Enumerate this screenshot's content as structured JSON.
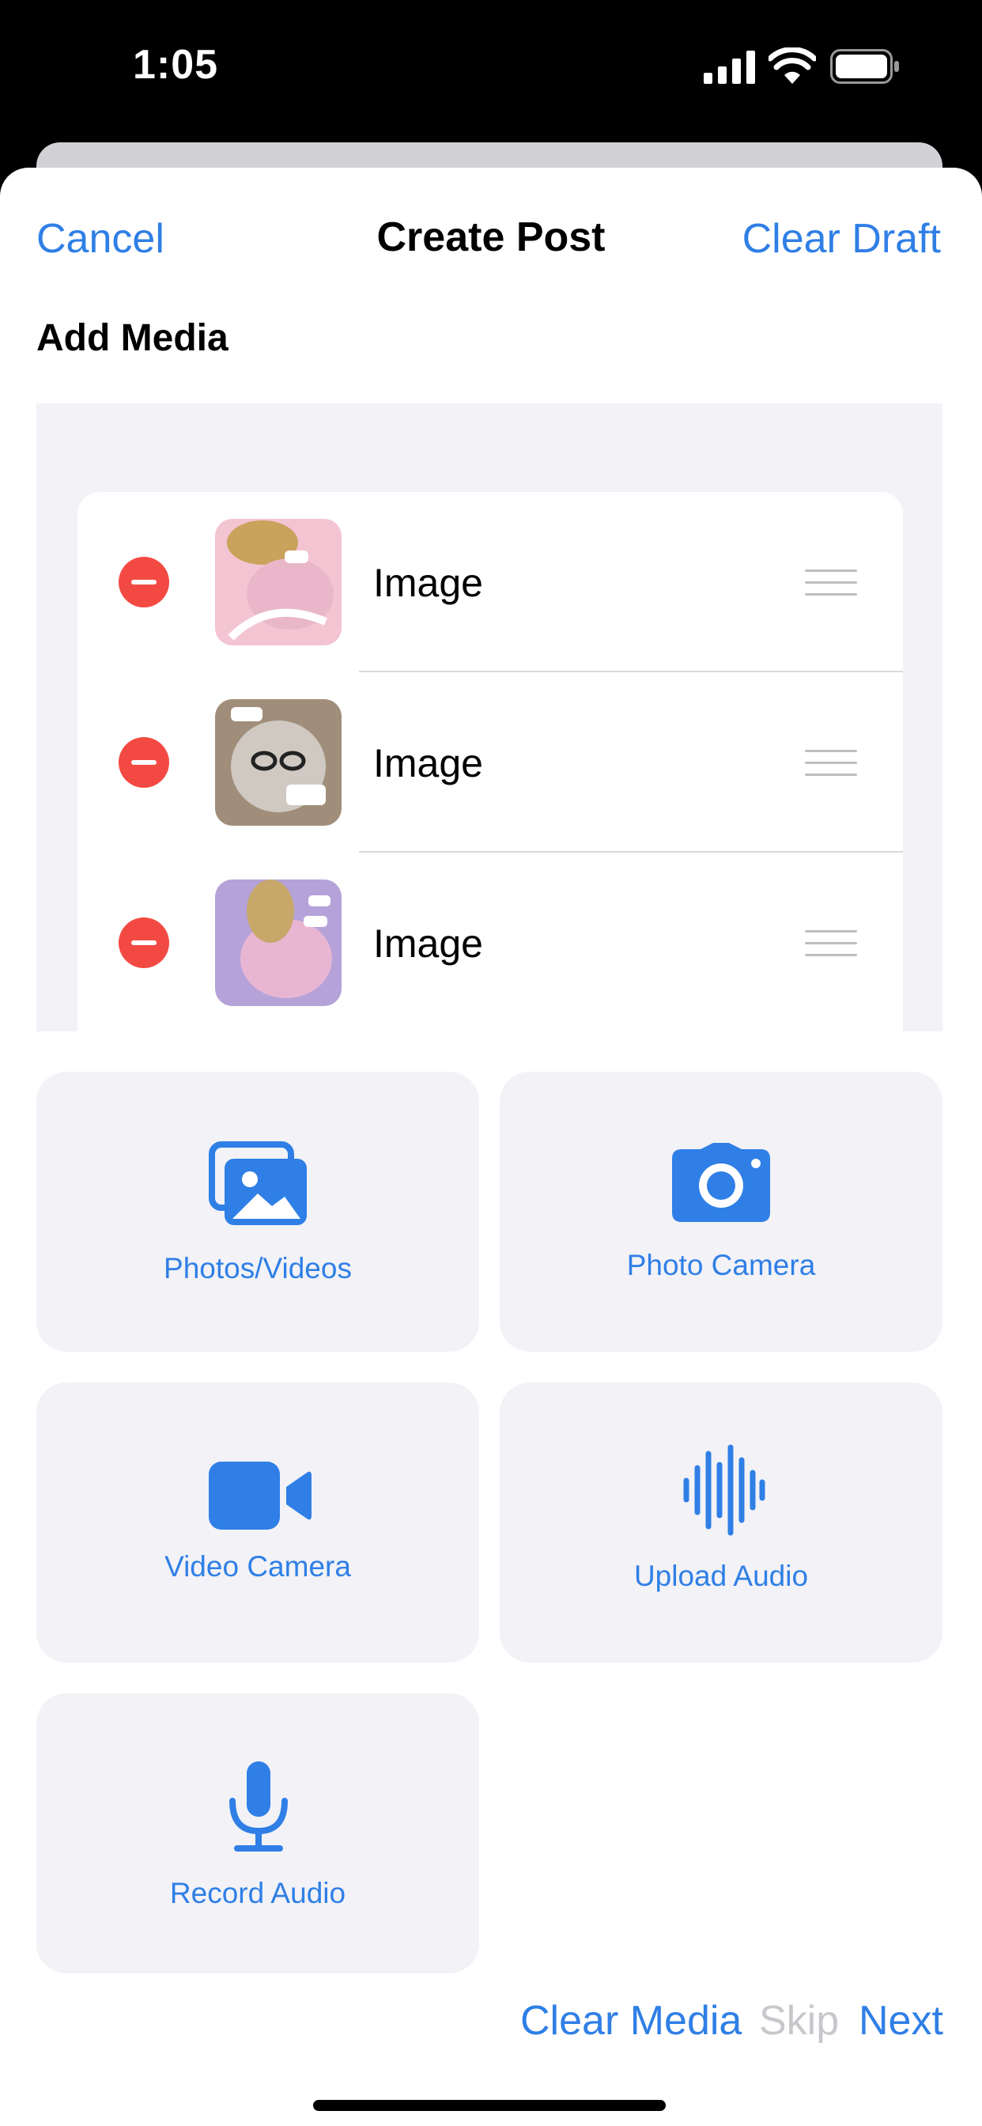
{
  "status_bar": {
    "time": "1:05"
  },
  "nav": {
    "cancel_label": "Cancel",
    "title": "Create Post",
    "clear_draft_label": "Clear Draft"
  },
  "section": {
    "title": "Add Media"
  },
  "media_items": [
    {
      "label": "Image",
      "thumb_colors": [
        "#f3c4d2",
        "#e9b7c9",
        "#c9a25c"
      ]
    },
    {
      "label": "Image",
      "thumb_colors": [
        "#a08e7a",
        "#cfc9c2",
        "#6b5d50"
      ]
    },
    {
      "label": "Image",
      "thumb_colors": [
        "#e8b6d3",
        "#b5a2d8",
        "#c7a86a"
      ]
    }
  ],
  "actions": {
    "photos_videos": "Photos/Videos",
    "photo_camera": "Photo Camera",
    "video_camera": "Video Camera",
    "upload_audio": "Upload Audio",
    "record_audio": "Record Audio"
  },
  "footer": {
    "clear_media": "Clear Media",
    "skip": "Skip",
    "next": "Next"
  },
  "colors": {
    "accent": "#2f7fe6",
    "disabled": "#c7c7cc",
    "delete": "#f24a43",
    "tile_bg": "#f2f2f7"
  }
}
